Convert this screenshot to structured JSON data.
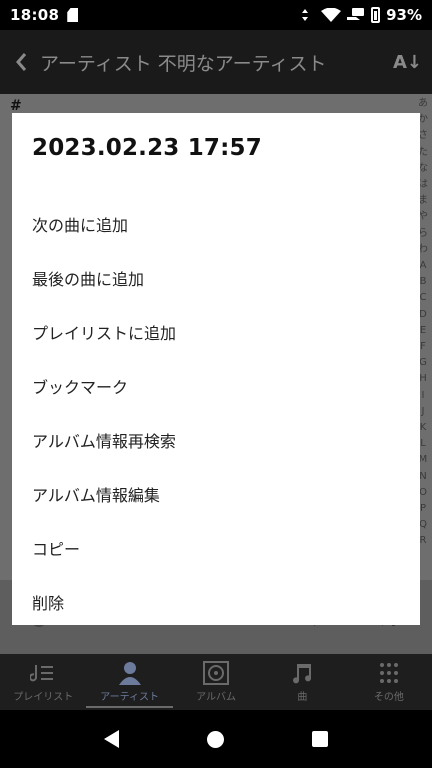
{
  "status_bar": {
    "time": "18:08",
    "battery": "93%"
  },
  "app_bar": {
    "title": "アーティスト 不明なアーティスト",
    "sort_label": "A↓"
  },
  "content": {
    "section_header": "#",
    "index_letters": [
      "あ",
      "か",
      "さ",
      "た",
      "な",
      "は",
      "ま",
      "や",
      "ら",
      "わ",
      "A",
      "B",
      "C",
      "D",
      "E",
      "F",
      "G",
      "H",
      "I",
      "J",
      "K",
      "L",
      "M",
      "N",
      "O",
      "P",
      "Q",
      "R"
    ]
  },
  "bottom_nav": {
    "items": [
      {
        "label": "プレイリスト",
        "icon": "playlist-icon"
      },
      {
        "label": "アーティスト",
        "icon": "artist-icon",
        "active": true
      },
      {
        "label": "アルバム",
        "icon": "album-icon"
      },
      {
        "label": "曲",
        "icon": "music-note-icon"
      },
      {
        "label": "その他",
        "icon": "more-grid-icon"
      }
    ]
  },
  "dialog": {
    "title": "2023.02.23 17:57",
    "menu": [
      "次の曲に追加",
      "最後の曲に追加",
      "プレイリストに追加",
      "ブックマーク",
      "アルバム情報再検索",
      "アルバム情報編集",
      "コピー",
      "削除"
    ]
  },
  "colors": {
    "dialog_bg": "#ffffff",
    "scrim": "#6e6e6e",
    "active_nav": "#6c7b9c"
  }
}
